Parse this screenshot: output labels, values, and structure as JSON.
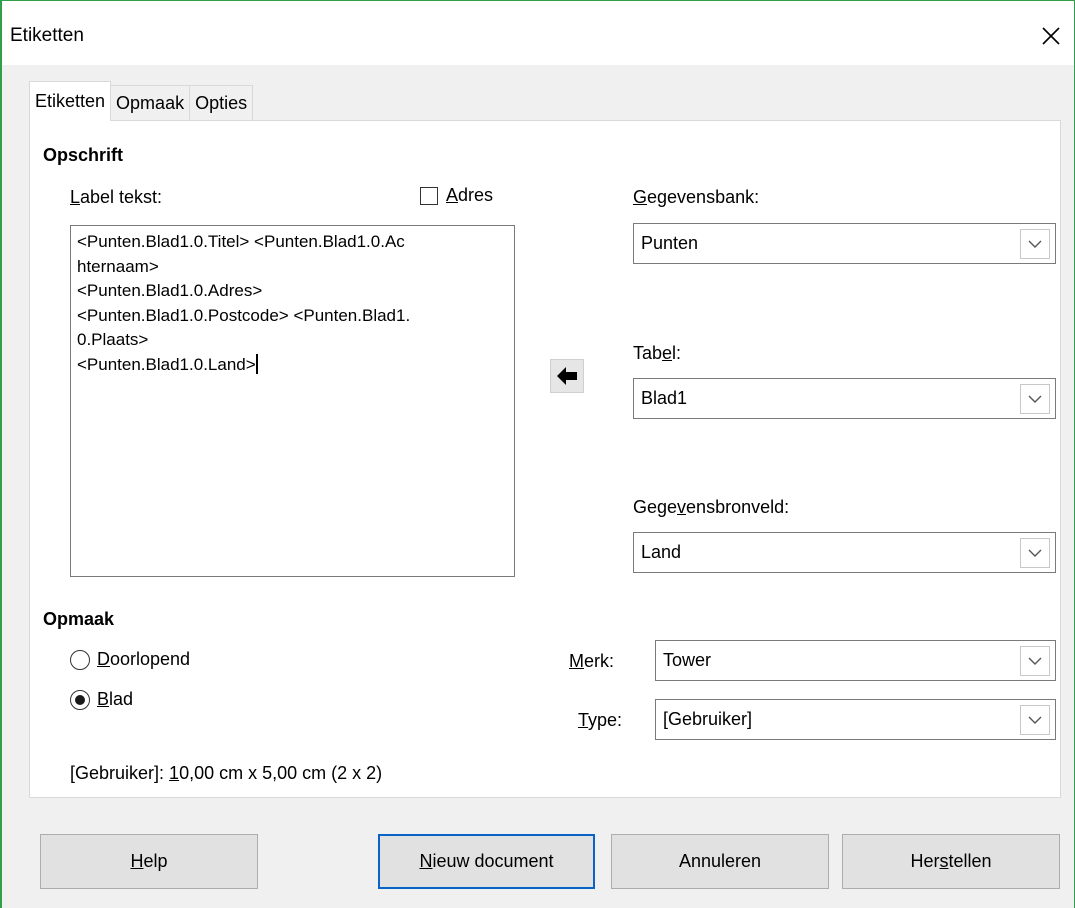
{
  "window": {
    "title": "Etiketten"
  },
  "tabs": [
    {
      "label": "Etiketten",
      "active": true
    },
    {
      "label": "Opmaak",
      "active": false
    },
    {
      "label": "Opties",
      "active": false
    }
  ],
  "opschrift": {
    "heading": "Opschrift",
    "label_text_label": "Label tekst:",
    "adres_checkbox": {
      "label": "Adres",
      "checked": false
    },
    "label_text_value": "<Punten.Blad1.0.Titel> <Punten.Blad1.0.Ac\nhternaam>\n<Punten.Blad1.0.Adres>\n<Punten.Blad1.0.Postcode> <Punten.Blad1.\n0.Plaats>\n<Punten.Blad1.0.Land>"
  },
  "database": {
    "gegevensbank_label": "Gegevensbank:",
    "gegevensbank_value": "Punten",
    "tabel_label": "Tabel:",
    "tabel_value": "Blad1",
    "bronveld_label": "Gegevensbronveld:",
    "bronveld_value": "Land",
    "insert_icon": "arrow-left-icon"
  },
  "opmaak": {
    "heading": "Opmaak",
    "radio_doorlopend": {
      "label": "Doorlopend",
      "selected": false
    },
    "radio_blad": {
      "label": "Blad",
      "selected": true
    },
    "merk_label": "Merk:",
    "merk_value": "Tower",
    "type_label": "Type:",
    "type_value": "[Gebruiker]",
    "info_prefix": "[Gebruiker]: ",
    "info_underlined": "1",
    "info_rest": "0,00 cm x 5,00 cm (2 x 2)"
  },
  "buttons": {
    "help": "Help",
    "nieuw_document": "Nieuw document",
    "annuleren": "Annuleren",
    "herstellen": "Herstellen"
  },
  "colors": {
    "default_button_border": "#0a64c8",
    "window_border": "#2f9f4a"
  }
}
